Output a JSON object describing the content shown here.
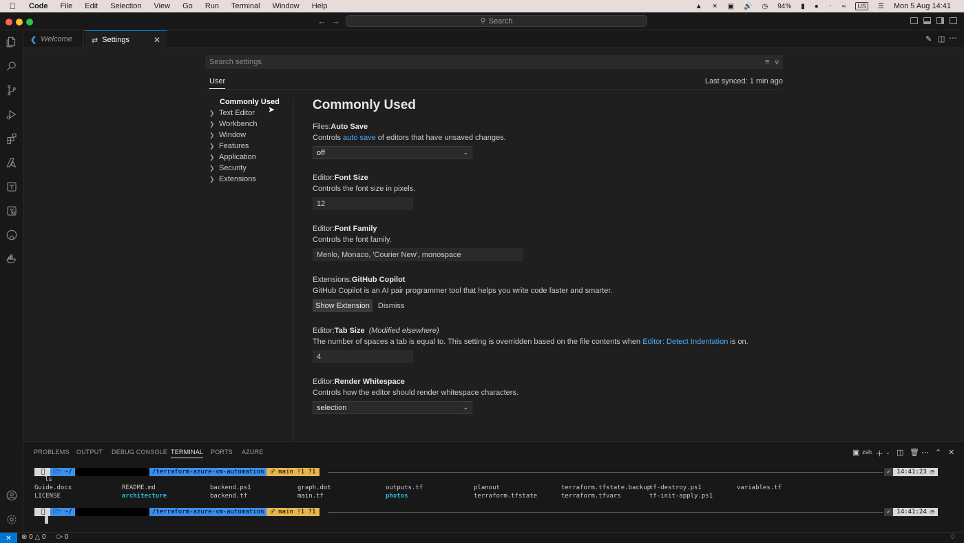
{
  "menubar": {
    "apple": "",
    "app": "Code",
    "items": [
      "File",
      "Edit",
      "Selection",
      "View",
      "Go",
      "Run",
      "Terminal",
      "Window",
      "Help"
    ],
    "battery": "94%",
    "input_source": "US",
    "datetime": "Mon 5 Aug  14:41"
  },
  "titlebar": {
    "search_label": "Search"
  },
  "tabs": {
    "welcome": "Welcome",
    "settings": "Settings"
  },
  "settings": {
    "search_placeholder": "Search settings",
    "scope": "User",
    "last_synced": "Last synced: 1 min ago",
    "toc": {
      "active": "Commonly Used",
      "items": [
        "Text Editor",
        "Workbench",
        "Window",
        "Features",
        "Application",
        "Security",
        "Extensions"
      ]
    },
    "section_title": "Commonly Used",
    "auto_save": {
      "category": "Files: ",
      "name": "Auto Save",
      "desc_pre": "Controls ",
      "desc_link": "auto save",
      "desc_post": " of editors that have unsaved changes.",
      "value": "off"
    },
    "font_size": {
      "category": "Editor: ",
      "name": "Font Size",
      "desc": "Controls the font size in pixels.",
      "value": "12"
    },
    "font_family": {
      "category": "Editor: ",
      "name": "Font Family",
      "desc": "Controls the font family.",
      "value": "Menlo, Monaco, 'Courier New', monospace"
    },
    "copilot": {
      "category": "Extensions: ",
      "name": "GitHub Copilot",
      "desc": "GitHub Copilot is an AI pair programmer tool that helps you write code faster and smarter.",
      "show_label": "Show Extension",
      "dismiss_label": "Dismiss"
    },
    "tab_size": {
      "category": "Editor: ",
      "name": "Tab Size",
      "modified": "(Modified elsewhere)",
      "desc_pre": "The number of spaces a tab is equal to. This setting is overridden based on the file contents when ",
      "desc_link": "Editor: Detect Indentation",
      "desc_post": " is on.",
      "value": "4"
    },
    "render_whitespace": {
      "category": "Editor: ",
      "name": "Render Whitespace",
      "desc": "Controls how the editor should render whitespace characters.",
      "value": "selection"
    }
  },
  "panel": {
    "tabs": [
      "PROBLEMS",
      "OUTPUT",
      "DEBUG CONSOLE",
      "TERMINAL",
      "PORTS",
      "AZURE"
    ],
    "shell": "zsh",
    "prompt": {
      "dir_prefix": "~/",
      "dir_suffix": "/terraform-azure-vm-automation",
      "git": "main !1 ?1",
      "time1": "14:41:23",
      "time2": "14:41:24"
    },
    "command": "ls",
    "files_row1": [
      "Guide.docx",
      "README.md",
      "backend.ps1",
      "graph.dot",
      "outputs.tf",
      "planout",
      "terraform.tfstate.backup",
      "tf-destroy.ps1",
      "variables.tf"
    ],
    "files_row2": [
      "LICENSE",
      "architecture",
      "backend.tf",
      "main.tf",
      "photos",
      "terraform.tfstate",
      "terraform.tfvars",
      "tf-init-apply.ps1"
    ]
  },
  "statusbar": {
    "errors": "0",
    "warnings": "0",
    "ports": "0"
  }
}
